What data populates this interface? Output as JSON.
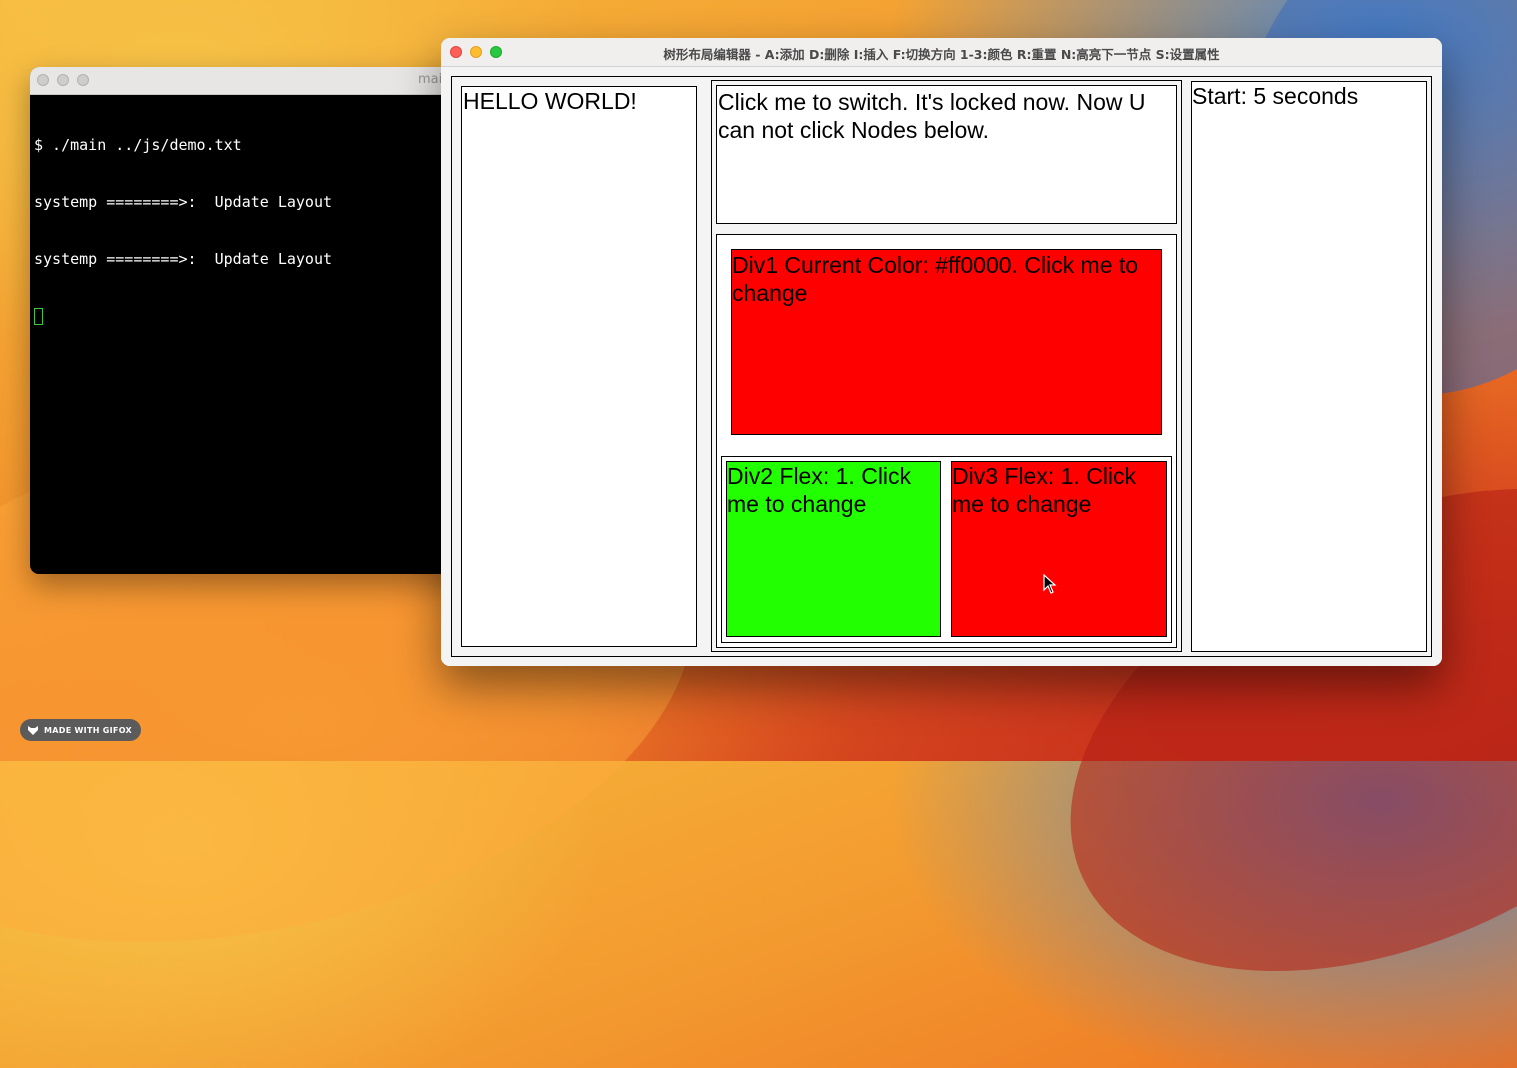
{
  "terminal": {
    "title": "main",
    "lines": [
      "$ ./main ../js/demo.txt",
      "systemp ========>:  Update Layout",
      "systemp ========>:  Update Layout"
    ]
  },
  "app": {
    "title": "树形布局编辑器 - A:添加 D:删除 I:插入 F:切换方向 1-3:颜色 R:重置 N:高亮下一节点 S:设置属性",
    "left_panel": {
      "text": "HELLO WORLD!"
    },
    "top_panel": {
      "text": "Click me to switch. It's locked now. Now U can not click Nodes below."
    },
    "div1": {
      "text": "Div1 Current Color: #ff0000. Click me to change",
      "color": "#ff0000"
    },
    "div2": {
      "text": "Div2 Flex: 1. Click me to change",
      "color": "#22ff00"
    },
    "div3": {
      "text": "Div3 Flex: 1. Click me to change",
      "color": "#ff0000"
    },
    "right_panel": {
      "text": "Start: 5 seconds"
    }
  },
  "watermark": {
    "text": "MADE WITH GIFOX"
  }
}
